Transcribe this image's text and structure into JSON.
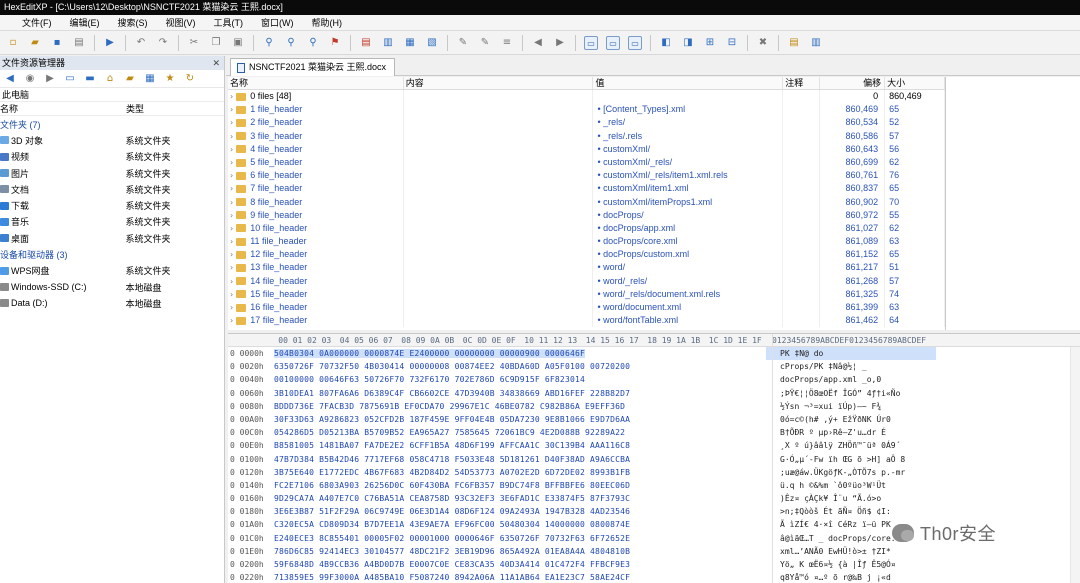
{
  "window": {
    "title": "HexEditXP - [C:\\Users\\12\\Desktop\\NSNCTF2021 菜猫染云 王熙.docx]"
  },
  "menu": [
    "文件(F)",
    "编辑(E)",
    "搜索(S)",
    "视图(V)",
    "工具(T)",
    "窗口(W)",
    "帮助(H)"
  ],
  "explorer": {
    "title": "文件资源管理器",
    "close": "✕",
    "path": "此电脑",
    "col_name": "名称",
    "col_type": "类型",
    "rows": [
      {
        "name": "文件夹 (7)",
        "type": "",
        "group": true,
        "color": ""
      },
      {
        "name": "3D 对象",
        "type": "系统文件夹",
        "group": false,
        "color": "#6aa8e6"
      },
      {
        "name": "视频",
        "type": "系统文件夹",
        "group": false,
        "color": "#4a78c8"
      },
      {
        "name": "图片",
        "type": "系统文件夹",
        "group": false,
        "color": "#5b9bd5"
      },
      {
        "name": "文档",
        "type": "系统文件夹",
        "group": false,
        "color": "#7c8fa6"
      },
      {
        "name": "下载",
        "type": "系统文件夹",
        "group": false,
        "color": "#2b7bd6"
      },
      {
        "name": "音乐",
        "type": "系统文件夹",
        "group": false,
        "color": "#3d8be0"
      },
      {
        "name": "桌面",
        "type": "系统文件夹",
        "group": false,
        "color": "#3a7fd0"
      },
      {
        "name": "设备和驱动器 (3)",
        "type": "",
        "group": true,
        "color": ""
      },
      {
        "name": "WPS网盘",
        "type": "系统文件夹",
        "group": false,
        "color": "#4f9be8"
      },
      {
        "name": "Windows-SSD (C:)",
        "type": "本地磁盘",
        "group": false,
        "color": "#8a8a8a"
      },
      {
        "name": "Data (D:)",
        "type": "本地磁盘",
        "group": false,
        "color": "#8a8a8a"
      }
    ]
  },
  "document_tab": {
    "label": "NSNCTF2021 菜猫染云 王熙.docx"
  },
  "file_table": {
    "headers": {
      "name": "名称",
      "content": "内容",
      "value": "值",
      "note": "注释",
      "offset": "偏移",
      "size": "大小"
    },
    "rows": [
      {
        "name": "0 files [48]",
        "value": "",
        "offset": "0",
        "size": "860,469"
      },
      {
        "name": "1 file_header",
        "value": "• [Content_Types].xml",
        "offset": "860,469",
        "size": "65"
      },
      {
        "name": "2 file_header",
        "value": "• _rels/",
        "offset": "860,534",
        "size": "52"
      },
      {
        "name": "3 file_header",
        "value": "• _rels/.rels",
        "offset": "860,586",
        "size": "57"
      },
      {
        "name": "4 file_header",
        "value": "• customXml/",
        "offset": "860,643",
        "size": "56"
      },
      {
        "name": "5 file_header",
        "value": "• customXml/_rels/",
        "offset": "860,699",
        "size": "62"
      },
      {
        "name": "6 file_header",
        "value": "• customXml/_rels/item1.xml.rels",
        "offset": "860,761",
        "size": "76"
      },
      {
        "name": "7 file_header",
        "value": "• customXml/item1.xml",
        "offset": "860,837",
        "size": "65"
      },
      {
        "name": "8 file_header",
        "value": "• customXml/itemProps1.xml",
        "offset": "860,902",
        "size": "70"
      },
      {
        "name": "9 file_header",
        "value": "• docProps/",
        "offset": "860,972",
        "size": "55"
      },
      {
        "name": "10 file_header",
        "value": "• docProps/app.xml",
        "offset": "861,027",
        "size": "62"
      },
      {
        "name": "11 file_header",
        "value": "• docProps/core.xml",
        "offset": "861,089",
        "size": "63"
      },
      {
        "name": "12 file_header",
        "value": "• docProps/custom.xml",
        "offset": "861,152",
        "size": "65"
      },
      {
        "name": "13 file_header",
        "value": "• word/",
        "offset": "861,217",
        "size": "51"
      },
      {
        "name": "14 file_header",
        "value": "• word/_rels/",
        "offset": "861,268",
        "size": "57"
      },
      {
        "name": "15 file_header",
        "value": "• word/_rels/document.xml.rels",
        "offset": "861,325",
        "size": "74"
      },
      {
        "name": "16 file_header",
        "value": "• word/document.xml",
        "offset": "861,399",
        "size": "63"
      },
      {
        "name": "17 file_header",
        "value": "• word/fontTable.xml",
        "offset": "861,462",
        "size": "64"
      }
    ]
  },
  "hex_view": {
    "header_offset": "",
    "header_groups": [
      "00 01 02 03",
      "04 05 06 07",
      "08 09 0A 0B",
      "0C 0D 0E 0F",
      "10 11 12 13",
      "14 15 16 17",
      "18 19 1A 1B",
      "1C 1D 1E 1F"
    ],
    "header_ascii": "0123456789ABCDEF0123456789ABCDEF",
    "rows": [
      {
        "offset": "0 0000h",
        "hex": "504B0304 0A000000 0000874E E2400000 00000000 00000900 0000646F",
        "ascii": "PK       ‡N@         do"
      },
      {
        "offset": "0 0020h",
        "hex": "6350726F 70732F50 4B030414 00000008 00874EE2 40BDA60D A05F0100 00720200",
        "ascii": "cProps/PK      ‡Nâ@½¦ _"
      },
      {
        "offset": "0 0040h",
        "hex": "00100000 00646F63 50726F70 732F6170 702E786D 6C9D915F 6F823014",
        "ascii": "     docProps/app.xml _o‚0"
      },
      {
        "offset": "0 0060h",
        "hex": "3B10DEA1 807FA6A6 D6389C4F CB6602CE 47D3940B 34838669 ABD16FEF 228B82D7",
        "ascii": ";ÞŸ€¦¦Ö8œOËf ÎGÓ” 4ƒ†i«Ño"
      },
      {
        "offset": "0 0080h",
        "hex": "BDDD736E 7FACB3D 7875691B EF0CDA70 29967E1C 46BE0782 C982B86A E9EFF36D",
        "ascii": "½Ýsn ¬³=xui ïÚp)–~ F¾"
      },
      {
        "offset": "0 00A0h",
        "hex": "30F33D63 A9286823 052CFD2B 187F459E 9FF04E4B 05DA7230 9E8B1066 E9D7D6AA",
        "ascii": "0ó=c©(h# ,ý+ EžŸðNK Úr0"
      },
      {
        "offset": "0 00C0h",
        "hex": "054286D5 D05213BA B5709B52 EA965A27 7585645 72061BC9 4E2D088B 92289A22",
        "ascii": " B†ÕÐR º µp›Rê–Z'u…dr É"
      },
      {
        "offset": "0 00E0h",
        "hex": "B8581005 1481BA07 FA7DE2E2 6CFF1B5A 48D6F199 AFFCAA1C 30C139B4 AAA116C8",
        "ascii": "¸X  º ú}ââlÿ ZHÖñ™¯üª 0Á9´"
      },
      {
        "offset": "0 0100h",
        "hex": "47B7D384 B5B42D46 7717EF68 058C4718 F5033E48 5D181261 D40F38AD A9A6CCBA",
        "ascii": "G·Ó„µ´-Fw ïh ŒG õ >H]  aÔ 8"
      },
      {
        "offset": "0 0120h",
        "hex": "3B75E640 E1772EDC 4B67F683 4B2D84D2 54D53773 A0702E2D 6D72DE02 8993B1FB",
        "ascii": ";uæ@áw.ÜKgöƒK-„ÒTÕ7s p.-mr"
      },
      {
        "offset": "0 0140h",
        "hex": "FC2E7106 6803A903 26256D0C 60F430BA FC6FB357 B9DC74F8 BFFBBFE6 80EEC06D",
        "ascii": "ü.q h ©&%m `ô0ºüo³W¹Üt"
      },
      {
        "offset": "0 0160h",
        "hex": "9D29CA7A A407E7C0 C76BA51A CEA8758D 93C32EF3 3E6FAD1C E33874F5 87F3793C",
        "ascii": " )Êz¤ çÀÇk¥ Î¨u “Ã.ó>o­"
      },
      {
        "offset": "0 0180h",
        "hex": "3E6E3B87 51F2F29A 06C9749E 06E3D1A4 08D6F124 09A2493A 1947B328 4AD23546",
        "ascii": ">n;‡Qòòš Ét ãÑ¤ Öñ$ ¢I:"
      },
      {
        "offset": "0 01A0h",
        "hex": "C320EC5A CD809D34 B7D7EE1A 43E9AE7A EF96FC00 50480304 14000000 0800874E",
        "ascii": "Ã ìZÍ€ 4·×î CéRz ï–ü PK"
      },
      {
        "offset": "0 01C0h",
        "hex": "E240ECE3 8C855401 00005F02 00001000 0000646F 6350726F 70732F63 6F72652E",
        "ascii": "â@ìãŒ…T   _     docProps/core."
      },
      {
        "offset": "0 01E0h",
        "hex": "786D6C85 92414EC3 30104577 48DC21F2 3EB19D96 865A492A 01EA8A4A 4804810B",
        "ascii": "xml…’ANÃ0 EwHÜ!ò>±  †ZI*"
      },
      {
        "offset": "0 0200h",
        "hex": "59F6848D 4B9CCB36 A4BD0D7B E0007C0E CE83CA35 40D3A414 01C472F4 FFBCF9E3",
        "ascii": "Yö„ K œË6¤½ {à |Îƒ Ê5@Ó¤"
      },
      {
        "offset": "0 0220h",
        "hex": "713859E5 99F3000A A485BA10 F5087240 8942A06A 11A1AB64 EA1E23C7 58AE24CF",
        "ascii": "q8Yå™ó  ¤…º õ r@‰B j ¡«d"
      },
      {
        "offset": "0 0240h",
        "hex": "0A05115A 834193F8 F0201425 1385860B 5D94A06D 0A0C6A49 CA305146 68696DC9",
        "ascii": "  Zƒ A“øð  %  …† ]” m jI"
      },
      {
        "offset": "0 0260h",
        "hex": "30366209 39375EED 50B5382F 74CE6D5D EA052EB9 B8E30BC0 3E21239C 83E5925B",
        "ascii": "06b 97^íPµ8/tÎm]ê .¹¸ã"
      }
    ]
  },
  "watermark": {
    "text": "Th0r安全"
  }
}
